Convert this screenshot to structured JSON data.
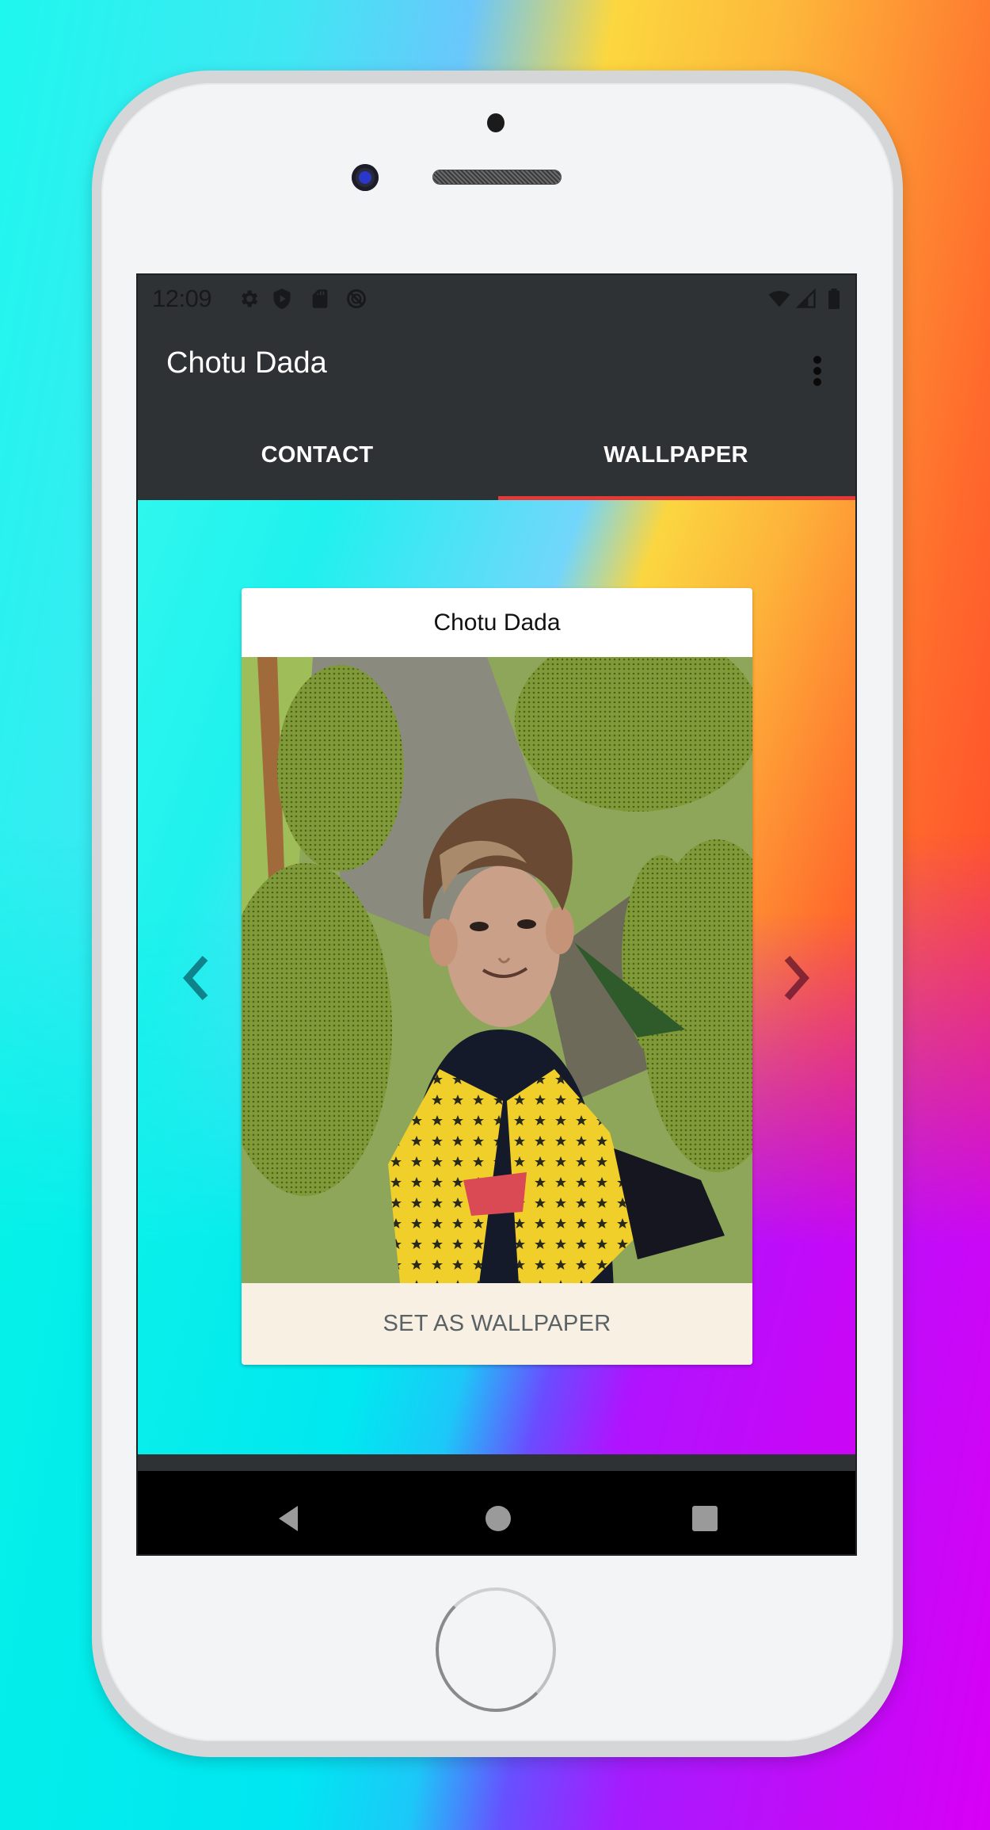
{
  "status_bar": {
    "time": "12:09",
    "left_icons": [
      "gear-icon",
      "shield-play-icon",
      "sd-card-icon",
      "no-sync-circle-icon"
    ],
    "right_icons": [
      "wifi-icon",
      "cell-signal-icon",
      "battery-icon"
    ]
  },
  "app_bar": {
    "title": "Chotu Dada",
    "overflow_menu_icon": "more-vert-icon"
  },
  "tabs": [
    {
      "label": "CONTACT",
      "selected": false
    },
    {
      "label": "WALLPAPER",
      "selected": true
    }
  ],
  "colors": {
    "app_bar_bg": "#2e3235",
    "tab_indicator": "#e53935",
    "button_bg": "#f7f0e3",
    "button_text": "#5b6266"
  },
  "wallpaper_card": {
    "title": "Chotu Dada",
    "image_alt": "Chotu Dada photo with jackfruits",
    "action_label": "SET AS WALLPAPER"
  },
  "carousel": {
    "prev_icon": "chevron-left-icon",
    "next_icon": "chevron-right-icon"
  },
  "nav_bar": {
    "buttons": [
      "back-icon",
      "home-icon",
      "recents-icon"
    ]
  }
}
